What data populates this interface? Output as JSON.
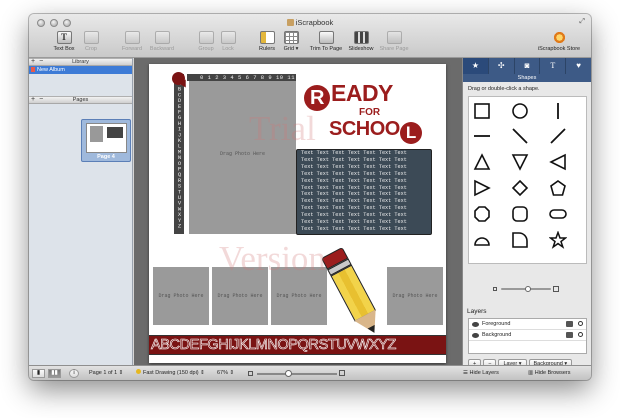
{
  "window": {
    "title": "iScrapbook"
  },
  "toolbar": {
    "items": [
      {
        "label": "Text Box",
        "enabled": true
      },
      {
        "label": "Crop",
        "enabled": false
      },
      {
        "label": "Forward",
        "enabled": false
      },
      {
        "label": "Backward",
        "enabled": false
      },
      {
        "label": "Group",
        "enabled": false
      },
      {
        "label": "Lock",
        "enabled": false
      },
      {
        "label": "Rulers",
        "enabled": true
      },
      {
        "label": "Grid",
        "enabled": true
      },
      {
        "label": "Trim To Page",
        "enabled": true
      },
      {
        "label": "Slideshow",
        "enabled": true
      },
      {
        "label": "Share Page",
        "enabled": false
      },
      {
        "label": "iScrapbook Store",
        "enabled": true
      }
    ]
  },
  "sidebar": {
    "library_header": "Library",
    "album_name": "New Album",
    "pages_header": "Pages",
    "page_thumb_label": "Page 4"
  },
  "page": {
    "number_strip": "0 1 2 3 4 5 6 7 8 9 10 11 12 13 14 15",
    "alphabet_vertical": "ABCDEFGHIJKLMNOPQRSTUVWXYZ",
    "photo_placeholder": "Drag Photo Here",
    "ready_circle": "R",
    "ready_rest": "EADY",
    "for": "FOR",
    "school_text": "SCHOO",
    "school_circle": "L",
    "textbox_line": "Text Text Text Text Text Text Text",
    "alphabet_bar": "ABCDEFGHIJKLMNOPQRSTUVWXYZ",
    "watermark_1": "Trial",
    "watermark_2": "Version"
  },
  "right_panel": {
    "tabs": [
      "star-tab",
      "puzzle-tab",
      "camera-tab",
      "text-tab",
      "heart-tab"
    ],
    "active_tab_caption": "Shapes",
    "hint": "Drag or double-click a shape.",
    "layers_header": "Layers",
    "layers": [
      "Foreground",
      "Background"
    ],
    "add_label": "+",
    "remove_label": "−",
    "layer_menu": "Layer",
    "layer_select": "Background"
  },
  "bottombar": {
    "page_indicator": "Page 1 of 1",
    "drawing_mode": "Fast Drawing (150 dpi)",
    "zoom": "67%",
    "hide_layers": "Hide Layers",
    "hide_browsers": "Hide Browsers"
  },
  "colors": {
    "accent_red": "#9b1d1d",
    "selection_blue": "#3d7bd6",
    "panel_blue": "#3d5a86",
    "textbox_slate": "#3c4a56"
  }
}
